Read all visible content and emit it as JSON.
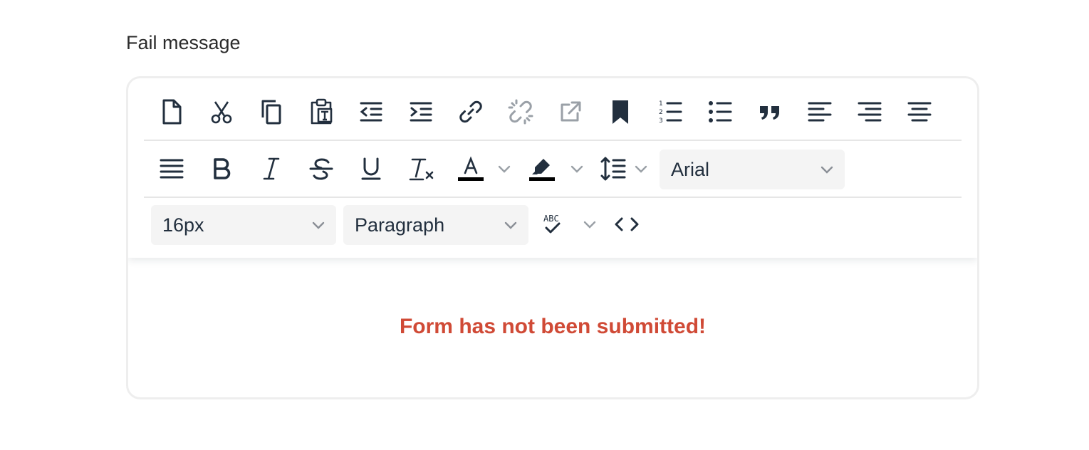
{
  "field": {
    "label": "Fail message"
  },
  "toolbar": {
    "font_family": "Arial",
    "font_size": "16px",
    "block_format": "Paragraph",
    "text_color": "#000000",
    "highlight_color": "#000000",
    "icons": {
      "row1": [
        "new-document-icon",
        "cut-icon",
        "copy-icon",
        "paste-as-text-icon",
        "outdent-icon",
        "indent-icon",
        "link-icon",
        "unlink-icon",
        "open-link-icon",
        "bookmark-icon",
        "numbered-list-icon",
        "bullet-list-icon",
        "blockquote-icon",
        "align-left-icon",
        "align-right-icon",
        "align-center-icon"
      ],
      "row2": [
        "align-justify-icon",
        "bold-icon",
        "italic-icon",
        "strikethrough-icon",
        "underline-icon",
        "clear-formatting-icon",
        "text-color-icon",
        "highlight-color-icon",
        "line-height-icon"
      ],
      "row3": [
        "spellcheck-icon",
        "source-code-icon"
      ]
    }
  },
  "editor": {
    "content": "Form has not been submitted!",
    "content_color": "#d04a36"
  }
}
